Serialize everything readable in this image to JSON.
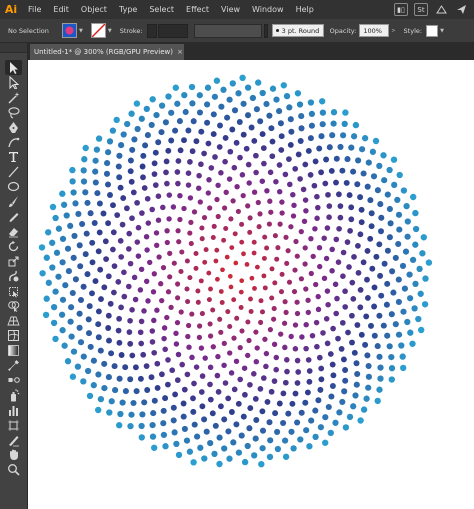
{
  "app": {
    "logo_text": "Ai",
    "logo_color": "#ff9a00"
  },
  "menu": {
    "items": [
      "File",
      "Edit",
      "Object",
      "Type",
      "Select",
      "Effect",
      "View",
      "Window",
      "Help"
    ]
  },
  "menubar_icons": [
    "workspace-bar-icon",
    "stock-icon",
    "libraries-icon",
    "send-icon"
  ],
  "control_bar": {
    "selection_label": "No Selection",
    "stroke_label": "Stroke:",
    "brush_value": "3 pt. Round",
    "opacity_label": "Opacity:",
    "opacity_value": "100%",
    "style_label": "Style:",
    "fill_swatch_icon": "fill-swatch-icon",
    "stroke_swatch_icon": "stroke-none-icon"
  },
  "document": {
    "tab_label": "Untitled-1* @ 300% (RGB/GPU Preview)",
    "close_glyph": "×"
  },
  "tools": [
    "selection-tool-icon",
    "direct-selection-tool-icon",
    "magic-wand-tool-icon",
    "lasso-tool-icon",
    "pen-tool-icon",
    "curvature-tool-icon",
    "type-tool-icon",
    "line-segment-tool-icon",
    "ellipse-tool-icon",
    "paintbrush-tool-icon",
    "pencil-tool-icon",
    "eraser-tool-icon",
    "rotate-tool-icon",
    "scale-tool-icon",
    "warp-tool-icon",
    "free-transform-tool-icon",
    "shape-builder-tool-icon",
    "perspective-grid-tool-icon",
    "mesh-tool-icon",
    "gradient-tool-icon",
    "eyedropper-tool-icon",
    "blend-tool-icon",
    "symbol-sprayer-tool-icon",
    "column-graph-tool-icon",
    "artboard-tool-icon",
    "slice-tool-icon",
    "hand-tool-icon",
    "zoom-tool-icon"
  ],
  "artwork": {
    "description_colors": {
      "center": "#d42a2f",
      "middle": "#7b2a8a",
      "mid_outer": "#2f3c8c",
      "outer": "#2ba0d0"
    },
    "dot_count": 940
  }
}
